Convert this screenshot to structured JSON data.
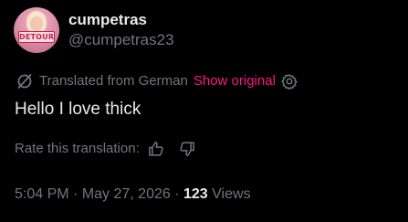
{
  "author": {
    "display_name": "cumpetras",
    "handle": "@cumpetras23",
    "avatar_badge_text": "DETOUR"
  },
  "translation": {
    "notice": "Translated from German",
    "show_original_label": "Show original",
    "icon": "translate-icon",
    "settings_icon": "gear-icon"
  },
  "post": {
    "text": "Hello I love thick"
  },
  "rating": {
    "prompt": "Rate this translation:",
    "thumbs_up_icon": "thumbs-up-icon",
    "thumbs_down_icon": "thumbs-down-icon"
  },
  "meta": {
    "time": "5:04 PM",
    "separator": " · ",
    "date": "May 27, 2026",
    "views_count": "123",
    "views_label": " Views"
  },
  "colors": {
    "background": "#000000",
    "primary_text": "#e7e9ea",
    "secondary_text": "#71767b",
    "accent": "#f91880"
  }
}
